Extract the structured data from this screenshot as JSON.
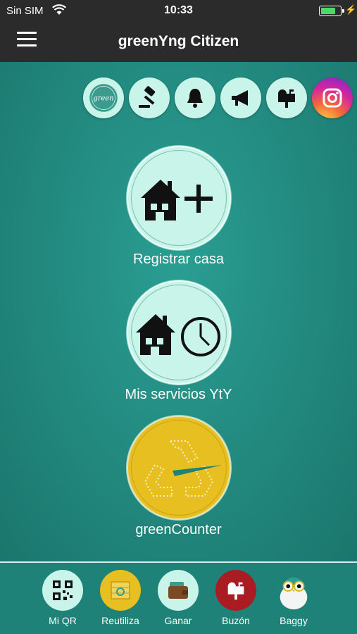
{
  "status": {
    "carrier": "Sin SIM",
    "time": "10:33",
    "battery_level": 0.75
  },
  "navbar": {
    "title": "greenYng Citizen"
  },
  "quick_icons": [
    {
      "icon": "green-logo-icon",
      "label": "green"
    },
    {
      "icon": "gavel-icon"
    },
    {
      "icon": "bell-icon"
    },
    {
      "icon": "megaphone-icon"
    },
    {
      "icon": "mailbox-icon"
    },
    {
      "icon": "instagram-icon"
    }
  ],
  "main": {
    "register_label": "Registrar casa",
    "services_label": "Mis servicios YtY",
    "counter_label": "greenCounter"
  },
  "tabs": [
    {
      "label": "Mi QR",
      "icon": "qr-code-icon"
    },
    {
      "label": "Reutiliza",
      "icon": "recycle-box-icon"
    },
    {
      "label": "Ganar",
      "icon": "wallet-icon"
    },
    {
      "label": "Buzón",
      "icon": "mailbox-icon"
    },
    {
      "label": "Baggy",
      "icon": "owl-mascot-icon"
    }
  ],
  "colors": {
    "background": "#1f8278",
    "bar": "#2b2b2b",
    "circle": "#c9f4ea",
    "counter": "#e7bf20",
    "mail": "#a81c22"
  }
}
